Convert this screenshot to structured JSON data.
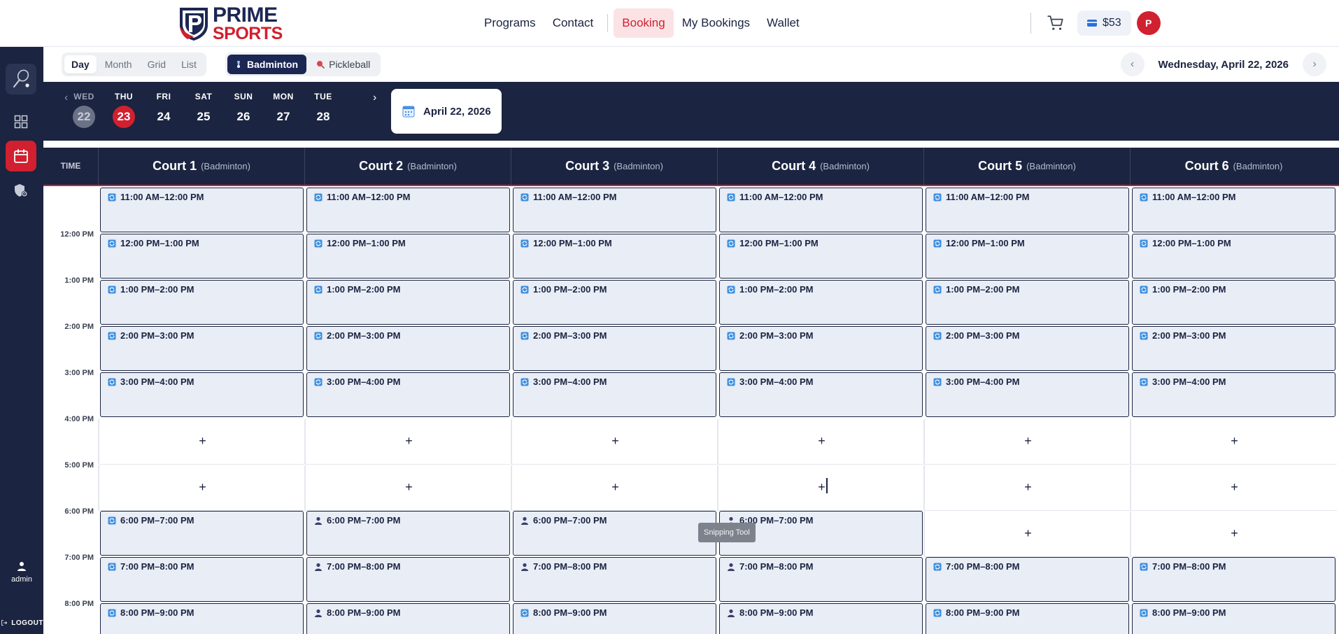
{
  "brand": {
    "word1": "PRIME",
    "word2": "SPORTS",
    "mark": "P"
  },
  "nav": {
    "items": [
      {
        "label": "Programs",
        "active": false
      },
      {
        "label": "Contact",
        "active": false
      },
      {
        "label": "Booking",
        "active": true
      },
      {
        "label": "My Bookings",
        "active": false
      },
      {
        "label": "Wallet",
        "active": false
      }
    ],
    "wallet_balance": "$53",
    "avatar_letter": "P",
    "cart_icon": "cart-icon"
  },
  "sidebar": {
    "items": [
      "racket-icon",
      "dashboard-icon",
      "calendar-icon",
      "shield-settings-icon"
    ],
    "user_label": "admin",
    "logout_label": "LOGOUT"
  },
  "toolbar": {
    "views": [
      "Day",
      "Month",
      "Grid",
      "List"
    ],
    "active_view": "Day",
    "sports": [
      "Badminton",
      "Pickleball"
    ],
    "active_sport": "Badminton",
    "current_date": "Wednesday, April 22, 2026",
    "prev_arrow": "‹",
    "next_arrow": "›"
  },
  "date_strip": {
    "days": [
      {
        "dow": "WED",
        "num": "22",
        "state": "past"
      },
      {
        "dow": "THU",
        "num": "23",
        "state": "today"
      },
      {
        "dow": "FRI",
        "num": "24",
        "state": ""
      },
      {
        "dow": "SAT",
        "num": "25",
        "state": ""
      },
      {
        "dow": "SUN",
        "num": "26",
        "state": ""
      },
      {
        "dow": "MON",
        "num": "27",
        "state": ""
      },
      {
        "dow": "TUE",
        "num": "28",
        "state": ""
      }
    ],
    "prev_arrow": "‹",
    "next_arrow": "›",
    "picker_label": "April 22, 2026"
  },
  "grid": {
    "time_header": "TIME",
    "courts": [
      {
        "name": "Court 1",
        "sport": "(Badminton)"
      },
      {
        "name": "Court 2",
        "sport": "(Badminton)"
      },
      {
        "name": "Court 3",
        "sport": "(Badminton)"
      },
      {
        "name": "Court 4",
        "sport": "(Badminton)"
      },
      {
        "name": "Court 5",
        "sport": "(Badminton)"
      },
      {
        "name": "Court 6",
        "sport": "(Badminton)"
      }
    ],
    "time_labels": [
      "12:00 PM",
      "1:00 PM",
      "2:00 PM",
      "3:00 PM",
      "4:00 PM",
      "5:00 PM",
      "6:00 PM",
      "7:00 PM",
      "8:00 PM"
    ],
    "rows": [
      {
        "label": "11:00 AM–12:00 PM",
        "cells": [
          "recurring",
          "recurring",
          "recurring",
          "recurring",
          "recurring",
          "recurring"
        ]
      },
      {
        "label": "12:00 PM–1:00 PM",
        "cells": [
          "recurring",
          "recurring",
          "recurring",
          "recurring",
          "recurring",
          "recurring"
        ]
      },
      {
        "label": "1:00 PM–2:00 PM",
        "cells": [
          "recurring",
          "recurring",
          "recurring",
          "recurring",
          "recurring",
          "recurring"
        ]
      },
      {
        "label": "2:00 PM–3:00 PM",
        "cells": [
          "recurring",
          "recurring",
          "recurring",
          "recurring",
          "recurring",
          "recurring"
        ]
      },
      {
        "label": "3:00 PM–4:00 PM",
        "cells": [
          "recurring",
          "recurring",
          "recurring",
          "recurring",
          "recurring",
          "recurring"
        ]
      },
      {
        "label": "4:00 PM–5:00 PM",
        "cells": [
          "available",
          "available",
          "available",
          "available",
          "available",
          "available"
        ]
      },
      {
        "label": "5:00 PM–6:00 PM",
        "cells": [
          "available",
          "available",
          "available",
          "available",
          "available",
          "available"
        ]
      },
      {
        "label": "6:00 PM–7:00 PM",
        "cells": [
          "recurring",
          "user",
          "user",
          "user",
          "available",
          "available"
        ]
      },
      {
        "label": "7:00 PM–8:00 PM",
        "cells": [
          "recurring",
          "user",
          "user",
          "user",
          "recurring",
          "recurring"
        ]
      },
      {
        "label": "8:00 PM–9:00 PM",
        "cells": [
          "recurring",
          "user",
          "recurring",
          "user",
          "recurring",
          "recurring"
        ]
      }
    ],
    "add_symbol": "+"
  },
  "tooltip": "Snipping Tool",
  "colors": {
    "navy": "#1b2440",
    "accent_red": "#d1202f",
    "booked_fill": "#e8edf6",
    "recurring_icon": "#3d8fe0",
    "user_icon": "#3b3f6b"
  }
}
